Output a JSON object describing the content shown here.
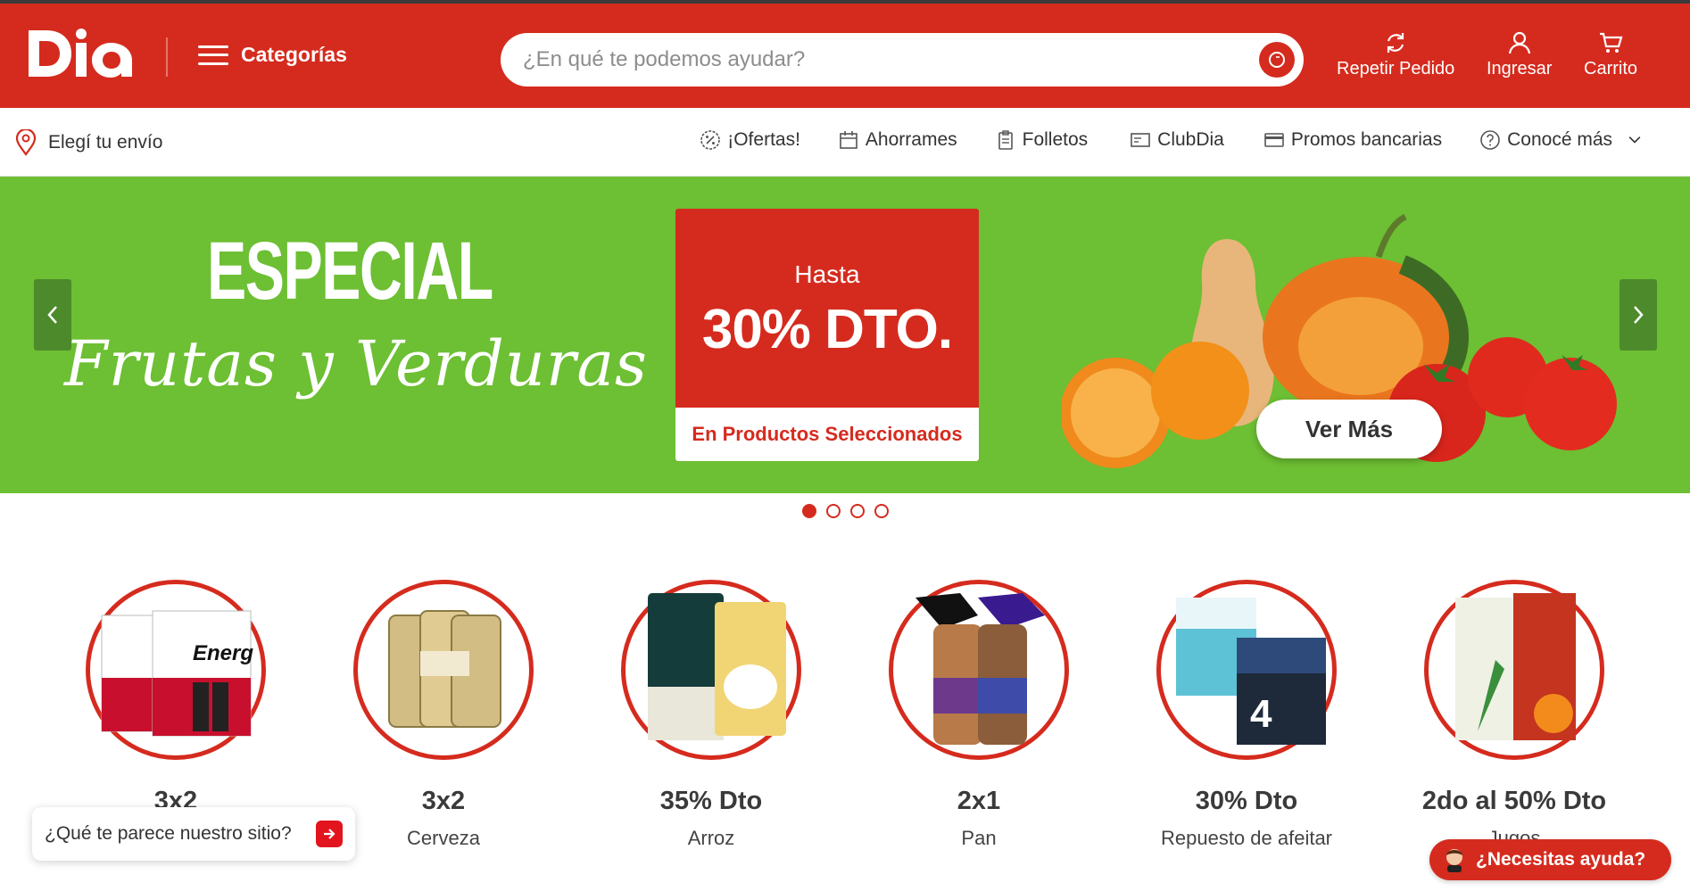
{
  "header": {
    "logo_text": "Dia",
    "categories_label": "Categorías",
    "search_placeholder": "¿En qué te podemos ayudar?",
    "actions": [
      {
        "label": "Repetir Pedido",
        "icon": "refresh-icon"
      },
      {
        "label": "Ingresar",
        "icon": "user-icon"
      },
      {
        "label": "Carrito",
        "icon": "cart-icon"
      }
    ]
  },
  "subnav": {
    "ship_label": "Elegí tu envío",
    "links": [
      {
        "label": "¡Ofertas!",
        "icon": "percent-badge-icon"
      },
      {
        "label": "Ahorrames",
        "icon": "calendar-icon"
      },
      {
        "label": "Folletos",
        "icon": "clipboard-icon"
      },
      {
        "label": "ClubDia",
        "icon": "card-icon"
      },
      {
        "label": "Promos bancarias",
        "icon": "credit-card-icon"
      },
      {
        "label": "Conocé más",
        "icon": "question-icon"
      }
    ]
  },
  "banner": {
    "headline": "ESPECIAL",
    "script_line": "Frutas y Verduras",
    "promo_small": "Hasta",
    "promo_big": "30% DTO.",
    "promo_footer": "En Productos Seleccionados",
    "cta": "Ver Más",
    "slides_total": 4,
    "active_slide": 1
  },
  "promos": [
    {
      "title": "3x2",
      "subtitle": "",
      "image": "energizer-batteries"
    },
    {
      "title": "3x2",
      "subtitle": "Cerveza",
      "image": "beer-cans"
    },
    {
      "title": "35% Dto",
      "subtitle": "Arroz",
      "image": "rice-bags"
    },
    {
      "title": "2x1",
      "subtitle": "Pan",
      "image": "bread-packs"
    },
    {
      "title": "30% Dto",
      "subtitle": "Repuesto de afeitar",
      "image": "razor-refills"
    },
    {
      "title": "2do al 50% Dto",
      "subtitle": "Jugos",
      "image": "juice-cartons"
    }
  ],
  "widgets": {
    "feedback_label": "¿Qué te parece nuestro sitio?",
    "help_label": "¿Necesitas ayuda?"
  },
  "colors": {
    "brand_red": "#d52b1e",
    "banner_green": "#6dbf33",
    "arrow_green": "#4c8a2b"
  }
}
